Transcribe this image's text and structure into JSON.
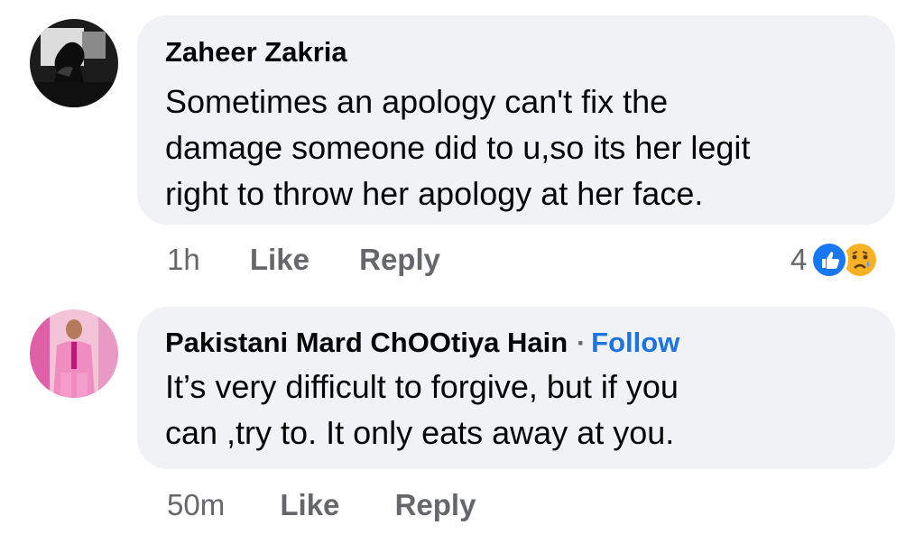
{
  "comments": [
    {
      "author": "Zaheer Zakria",
      "text_lines": [
        "Sometimes an apology can't fix the",
        "damage someone did to u,so its her legit",
        "right to throw her apology at her face."
      ],
      "time": "1h",
      "like_label": "Like",
      "reply_label": "Reply",
      "reaction_count": "4",
      "reactions": [
        "like-icon",
        "sad-face-icon"
      ],
      "avatar": "avatar-icon"
    },
    {
      "author": "Pakistani Mard ChOOtiya Hain",
      "separator": "·",
      "follow_label": "Follow",
      "text_lines": [
        "It’s very difficult to forgive, but if you",
        "can ,try to. It only eats away at you."
      ],
      "time": "50m",
      "like_label": "Like",
      "reply_label": "Reply",
      "avatar": "avatar-icon"
    }
  ],
  "colors": {
    "bubble": "#f0f2f5",
    "meta": "#65676b",
    "follow": "#1b74e4",
    "like": "#1877f2",
    "sad": "#f7b125"
  }
}
